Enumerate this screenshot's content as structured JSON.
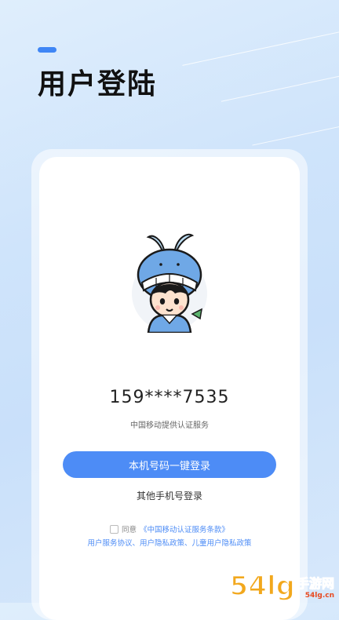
{
  "header": {
    "title": "用户登陆"
  },
  "login": {
    "phone_number": "159****7535",
    "carrier_note": "中国移动提供认证服务",
    "one_click_button": "本机号码一键登录",
    "other_phone_login": "其他手机号登录"
  },
  "agreement": {
    "agree_text": "同意",
    "cmcc_terms": "《中国移动认证服务条款》",
    "policies": "用户服务协议、用户隐私政策、儿童用户隐私政策",
    "checked": false
  },
  "watermark": {
    "number": "54lg",
    "cn": "手游网",
    "en": "54lg.cn"
  },
  "colors": {
    "accent": "#4d8cf6",
    "background": "#cfe4fb"
  }
}
